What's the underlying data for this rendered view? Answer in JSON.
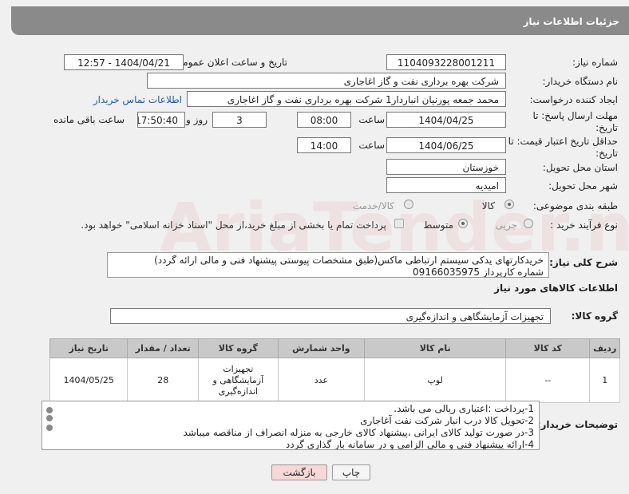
{
  "header": {
    "title": "جزئیات اطلاعات نیاز"
  },
  "fields": {
    "need_number_label": "شماره نیاز:",
    "need_number": "1104093228001211",
    "announce_label": "تاریخ و ساعت اعلان عمومی:",
    "announce_value": "1404/04/21 - 12:57",
    "buyer_org_label": "نام دستگاه خریدار:",
    "buyer_org": "شرکت بهره برداری نفت و گاز اغاجاری",
    "requester_label": "ایجاد کننده درخواست:",
    "requester": "محمد جمعه پورنیان انباردار1 شرکت بهره برداری نفت و گاز اغاجاری",
    "contact_link": "اطلاعات تماس خریدار",
    "deadline_label": "مهلت ارسال پاسخ: تا تاریخ:",
    "deadline_date": "1404/04/25",
    "time_label": "ساعت",
    "deadline_time": "08:00",
    "days_value": "3",
    "days_label": "روز و",
    "remaining_time": "17:50:40",
    "remaining_label": "ساعت باقی مانده",
    "price_validity_label": "حداقل تاریخ اعتبار قیمت: تا تاریخ:",
    "price_validity_date": "1404/06/25",
    "price_validity_time": "14:00",
    "province_label": "استان محل تحویل:",
    "province": "خوزستان",
    "city_label": "شهر محل تحویل:",
    "city": "امیدیه",
    "category_label": "طبقه بندی موضوعی:",
    "cat_goods": "کالا",
    "cat_goods_service": "کالا/خدمت",
    "process_label": "نوع فرآیند خرید :",
    "proc_small": "جزیی",
    "proc_medium": "متوسط",
    "payment_note": "پرداخت تمام یا بخشی از مبلغ خرید،از محل \"اسناد خزانه اسلامی\" خواهد بود.",
    "desc_label": "شرح کلی نیاز:",
    "desc_text": "خریدکارتهای یدکی سیستم ارتباطی ماکس(طبق مشخصات پیوستی پیشنهاد فنی و مالی ارائه گردد)\nشماره کارپرداز         09166035975",
    "goods_info_title": "اطلاعات کالاهای مورد نیاز",
    "goods_group_label": "گروه کالا:",
    "goods_group": "تجهیزات آزمایشگاهی و اندازه‌گیری"
  },
  "table": {
    "headers": [
      "ردیف",
      "کد کالا",
      "نام کالا",
      "واحد شمارش",
      "گروه کالا",
      "تعداد / مقدار",
      "تاریخ نیاز"
    ],
    "rows": [
      [
        "1",
        "--",
        "لوپ",
        "عدد",
        "تجهیزات آزمایشگاهی و اندازه‌گیری",
        "28",
        "1404/05/25"
      ]
    ]
  },
  "buyer_notes_label": "توضیحات خریدار:",
  "buyer_notes": "1-پرداخت :اعتباری ریالی می باشد.\n2-تحویل کالا درب انبار شرکت نفت آغاجاری\n3-در صورت تولید کالای ایرانی ،پیشنهاد کالای خارجی به منزله انصراف از مناقصه میباشد\n4-ارائه پیشنهاد فنی و مالی الزامی و در سامانه بار گذاری گردد",
  "buttons": {
    "print": "چاپ",
    "back": "بازگشت"
  },
  "watermark": "AriaTender.net",
  "colors": {
    "header": "#8a8a8a",
    "link": "#1a5fb4",
    "back_button": "#f8d7d7"
  }
}
